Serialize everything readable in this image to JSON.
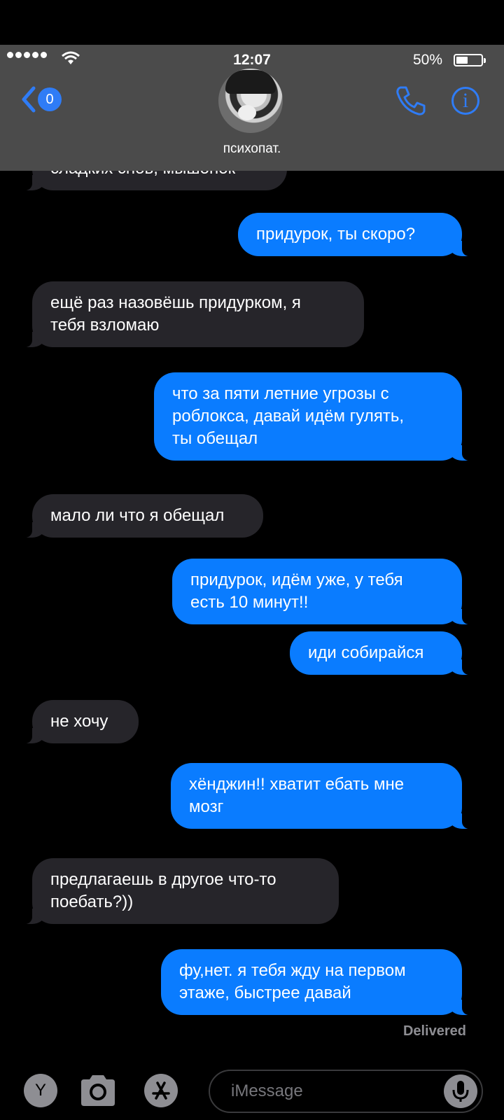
{
  "status": {
    "time": "12:07",
    "battery": "50%"
  },
  "header": {
    "unread_count": "0",
    "contact_name": "психопат.",
    "accent": "#2f7cf6"
  },
  "messages": [
    {
      "dir": "in",
      "text": "сладких снов, мышонок"
    },
    {
      "dir": "out",
      "text": "придурок, ты скоро?"
    },
    {
      "dir": "in",
      "text": "ещё раз назовёшь придурком, я\nтебя взломаю"
    },
    {
      "dir": "out",
      "text": "что за пяти летние угрозы с\nроблокса, давай идём гулять,\nты обещал"
    },
    {
      "dir": "in",
      "text": "мало ли что я обещал"
    },
    {
      "dir": "out",
      "text": "придурок, идём уже, у тебя\nесть 10 минут!!"
    },
    {
      "dir": "out",
      "text": "иди собирайся"
    },
    {
      "dir": "in",
      "text": "не хочу"
    },
    {
      "dir": "out",
      "text": "хёнджин!! хватит ебать мне\nмозг"
    },
    {
      "dir": "in",
      "text": "предлагаешь в другое что-то\nпоебать?))"
    },
    {
      "dir": "out",
      "text": "фу,нет. я тебя жду на первом\nэтаже, быстрее давай"
    }
  ],
  "delivered": "Delivered",
  "composer": {
    "app_y": "Y",
    "placeholder": "iMessage"
  },
  "icons": [
    "wifi-icon",
    "back-chevron-icon",
    "phone-icon",
    "info-icon",
    "camera-icon",
    "app-store-icon",
    "mic-icon"
  ]
}
